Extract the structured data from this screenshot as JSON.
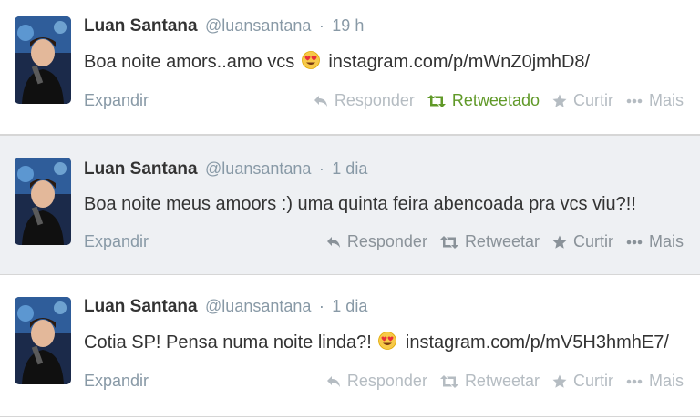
{
  "tweets": [
    {
      "name": "Luan Santana",
      "handle": "@luansantana",
      "separator": "·",
      "time": "19 h",
      "text_before": "Boa noite amors..amo vcs",
      "emoji_icon": "heart-eyes-emoji",
      "link": "instagram.com/p/mWnZ0jmhD8/",
      "text_after": "",
      "expand": "Expandir",
      "actions": {
        "reply": "Responder",
        "retweet": "Retweetado",
        "favorite": "Curtir",
        "more": "Mais"
      },
      "retweeted": true
    },
    {
      "name": "Luan Santana",
      "handle": "@luansantana",
      "separator": "·",
      "time": "1 dia",
      "text_before": "Boa noite meus amoors :) uma quinta feira abencoada pra vcs viu?!!",
      "emoji_icon": "",
      "link": "",
      "text_after": "",
      "expand": "Expandir",
      "actions": {
        "reply": "Responder",
        "retweet": "Retweetar",
        "favorite": "Curtir",
        "more": "Mais"
      },
      "retweeted": false
    },
    {
      "name": "Luan Santana",
      "handle": "@luansantana",
      "separator": "·",
      "time": "1 dia",
      "text_before": "Cotia SP! Pensa numa noite linda?!",
      "emoji_icon": "heart-eyes-emoji",
      "link": "instagram.com/p/mV5H3hmhE7/",
      "text_after": "",
      "expand": "Expandir",
      "actions": {
        "reply": "Responder",
        "retweet": "Retweetar",
        "favorite": "Curtir",
        "more": "Mais"
      },
      "retweeted": false
    }
  ],
  "colors": {
    "retweeted": "#609928",
    "meta_gray": "#8899a6",
    "hover_background": "#eef0f3"
  }
}
